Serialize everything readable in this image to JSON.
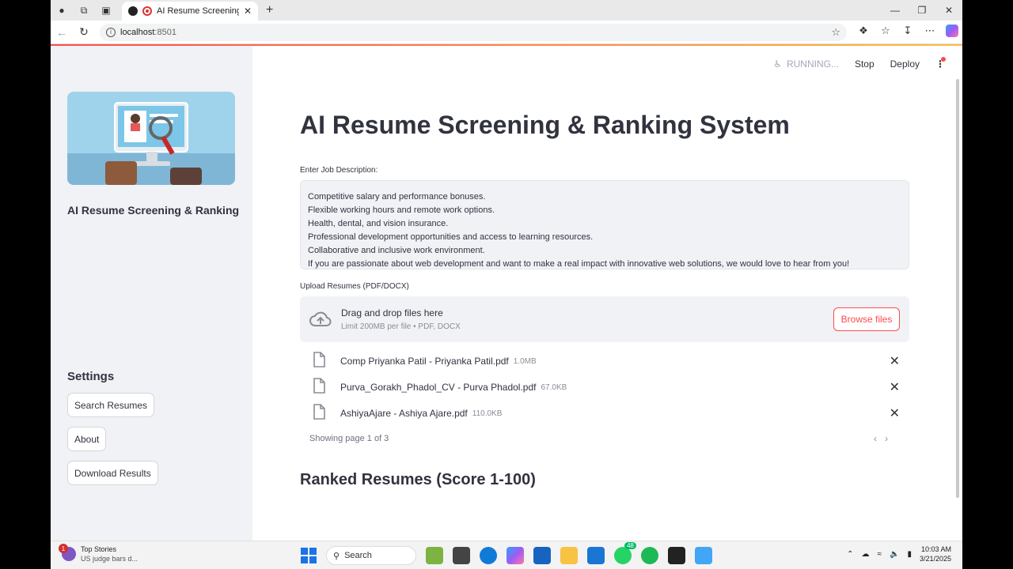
{
  "browser": {
    "tab_title": "AI Resume Screening",
    "url_host": "localhost",
    "url_port": ":8501"
  },
  "sidebar": {
    "title": "AI Resume Screening & Ranking",
    "settings_heading": "Settings",
    "buttons": [
      "Search Resumes",
      "About",
      "Download Results"
    ]
  },
  "toolbar": {
    "status": "RUNNING...",
    "stop": "Stop",
    "deploy": "Deploy"
  },
  "main": {
    "title": "AI Resume Screening & Ranking System",
    "jd_label": "Enter Job Description:",
    "jd_lines": [
      "Competitive salary and performance bonuses.",
      "Flexible working hours and remote work options.",
      "Health, dental, and vision insurance.",
      "Professional development opportunities and access to learning resources.",
      "Collaborative and inclusive work environment.",
      "If you are passionate about web development and want to make a real impact with innovative web solutions, we would love to hear from you!"
    ],
    "upload_label": "Upload Resumes (PDF/DOCX)",
    "dropzone_main": "Drag and drop files here",
    "dropzone_sub": "Limit 200MB per file • PDF, DOCX",
    "browse": "Browse files",
    "files": [
      {
        "name": "Comp Priyanka Patil - Priyanka Patil.pdf",
        "size": "1.0MB"
      },
      {
        "name": "Purva_Gorakh_Phadol_CV - Purva Phadol.pdf",
        "size": "67.0KB"
      },
      {
        "name": "AshiyaAjare - Ashiya Ajare.pdf",
        "size": "110.0KB"
      }
    ],
    "pager": "Showing page 1 of 3",
    "ranked_heading": "Ranked Resumes (Score 1-100)"
  },
  "taskbar": {
    "news_title": "Top Stories",
    "news_sub": "US judge bars d...",
    "news_badge": "1",
    "search": "Search",
    "whatsapp_count": "48",
    "time": "10:03 AM",
    "date": "3/21/2025"
  },
  "colors": {
    "accent": "#ff4b4b",
    "sidebar_bg": "#f0f2f6",
    "text": "#31333f"
  }
}
